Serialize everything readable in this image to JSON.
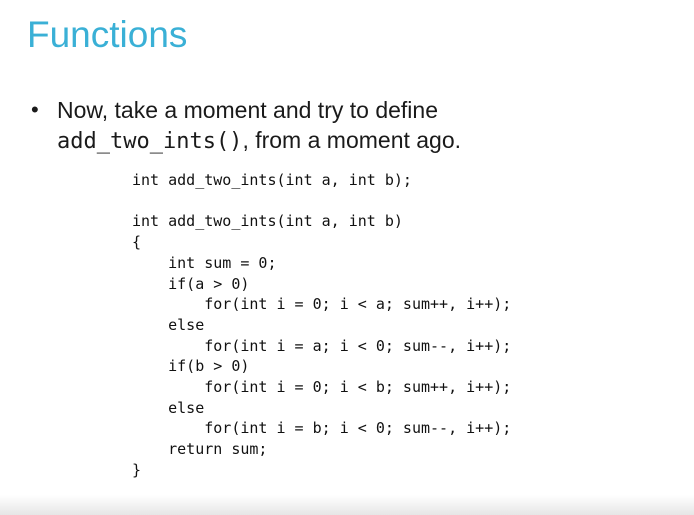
{
  "title": "Functions",
  "bullet": {
    "marker": "•",
    "line1": "Now, take a moment and try to define",
    "code_fn": "add_two_ints()",
    "line2_suffix": ", from a moment ago."
  },
  "code_lines": [
    "int add_two_ints(int a, int b);",
    "",
    "int add_two_ints(int a, int b)",
    "{",
    "    int sum = 0;",
    "    if(a > 0)",
    "        for(int i = 0; i < a; sum++, i++);",
    "    else",
    "        for(int i = a; i < 0; sum--, i++);",
    "    if(b > 0)",
    "        for(int i = 0; i < b; sum++, i++);",
    "    else",
    "        for(int i = b; i < 0; sum--, i++);",
    "    return sum;",
    "}"
  ]
}
